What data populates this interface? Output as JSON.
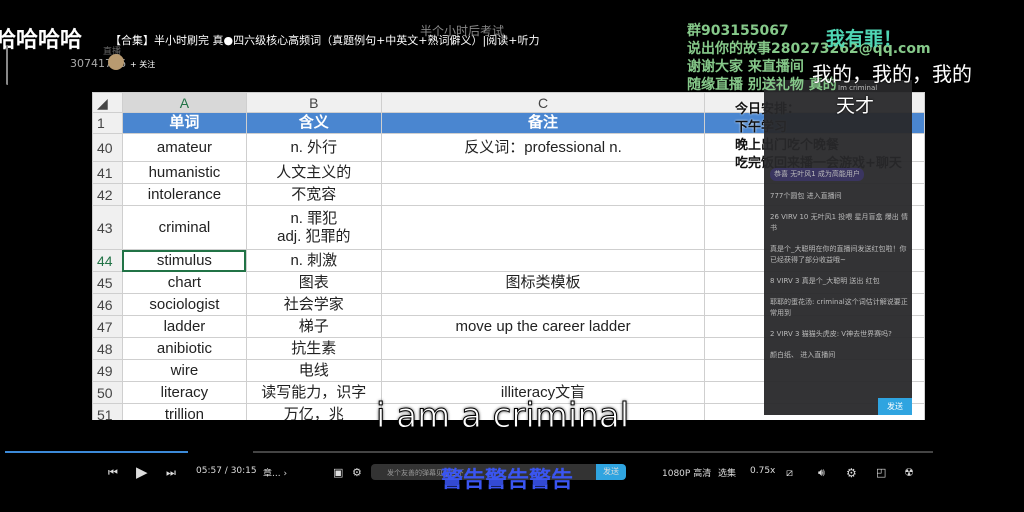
{
  "overlay": {
    "laugh": "哈哈哈哈",
    "video_title": "【合集】半小时刷完 真●四六级核心高频词（真题例句+中英文+熟词僻义）|阅读+听力",
    "exam_note": "半个小时后考试",
    "live_label": "直播",
    "uploader_id": "30741706",
    "follow": "+ 关注",
    "green_lines": [
      "群903155067",
      "说出你的故事280273262@qq.com",
      "谢谢大家 来直播间",
      "随缘直播 别送礼物 真的"
    ],
    "danmaku_guilty": "我有罪！",
    "danmaku_mine": "我的，我的，我的",
    "danmaku_genius": "天才",
    "plan": [
      "今日安排：",
      "下午学习",
      "晚上出门吃个晚餐",
      "吃完饭回来播一会游戏+聊天"
    ],
    "subtitle": "i am a criminal",
    "warning": "警告警告警告"
  },
  "sheet": {
    "columns": [
      "A",
      "B",
      "C"
    ],
    "header": {
      "row": "1",
      "cols": [
        "单词",
        "含义",
        "备注"
      ]
    },
    "rows": [
      {
        "n": "40",
        "word": "amateur",
        "meaning": "n. 外行",
        "note": "反义词：professional  n."
      },
      {
        "n": "41",
        "word": "humanistic",
        "meaning": "人文主义的",
        "note": ""
      },
      {
        "n": "42",
        "word": "intolerance",
        "meaning": "不宽容",
        "note": ""
      },
      {
        "n": "43",
        "word": "criminal",
        "meaning": "n. 罪犯\nadj. 犯罪的",
        "note": ""
      },
      {
        "n": "44",
        "word": "stimulus",
        "meaning": "n. 刺激",
        "note": ""
      },
      {
        "n": "45",
        "word": "chart",
        "meaning": "图表",
        "note": "图标类模板"
      },
      {
        "n": "46",
        "word": "sociologist",
        "meaning": "社会学家",
        "note": ""
      },
      {
        "n": "47",
        "word": "ladder",
        "meaning": "梯子",
        "note": "move up the career ladder"
      },
      {
        "n": "48",
        "word": "anibiotic",
        "meaning": "抗生素",
        "note": ""
      },
      {
        "n": "49",
        "word": "wire",
        "meaning": "电线",
        "note": ""
      },
      {
        "n": "50",
        "word": "literacy",
        "meaning": "读写能力，识字",
        "note": "illiteracy文盲"
      },
      {
        "n": "51",
        "word": "trillion",
        "meaning": "万亿，兆",
        "note": ""
      }
    ]
  },
  "chat": {
    "top_peek": "Im criminal",
    "messages": [
      "恭喜 无叶风1 成为高能用户",
      "777个圆包 进入直播间",
      "26 VIRV 10 无叶风1 投喂 星月盲盒 爆出 情书",
      "真是个_大聪明在你的直播间发送红包啦！你已经获得了部分收益哦~",
      "8 VIRV 3 真是个_大聪明 送出 红包",
      "耶耶的蛋花汤: criminal这个词估计解说要正常用到",
      "2 VIRV 3 猫猫头虎皮: V神去世界赛吗?",
      "颜白纸、 进入直播间"
    ],
    "send": "发送"
  },
  "player": {
    "time": "05:57 / 30:15",
    "chapter": "章...",
    "danmaku_placeholder": "发个友善的弹幕见证当下",
    "send": "发送",
    "quality": "1080P 高清",
    "episodes": "选集",
    "speed": "0.75x",
    "progress_fraction": 0.197
  }
}
